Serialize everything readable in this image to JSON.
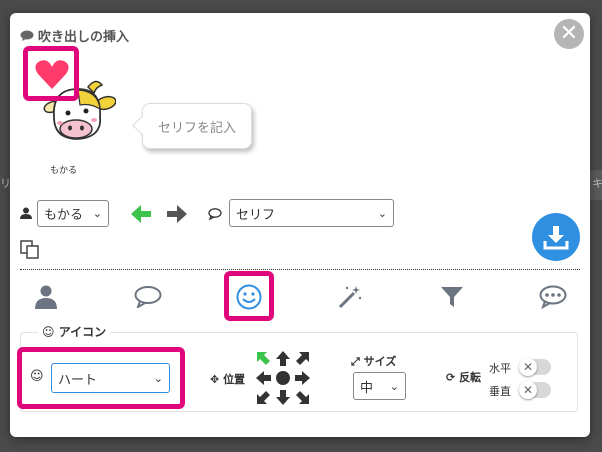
{
  "background": {
    "items": [
      "リ",
      "キ"
    ]
  },
  "dialog": {
    "title": "吹き出しの挿入",
    "close_symbol": "✕"
  },
  "character": {
    "name": "もかる",
    "speech_placeholder": "セリフを記入"
  },
  "controls": {
    "character_select": "もかる",
    "bubble_select": "セリフ"
  },
  "tabs": [
    {
      "name": "person"
    },
    {
      "name": "speech"
    },
    {
      "name": "icon",
      "active": true
    },
    {
      "name": "effect"
    },
    {
      "name": "filter"
    },
    {
      "name": "more"
    }
  ],
  "icon_section": {
    "legend": "アイコン",
    "icon_select": "ハート",
    "position_label": "位置",
    "size_label": "サイズ",
    "size_value": "中",
    "flip_label": "反転",
    "flip_horizontal": "水平",
    "flip_vertical": "垂直"
  },
  "colors": {
    "highlight": "#e0077d",
    "download": "#2f8fe0",
    "arrow_green": "#3cc34a",
    "heart": "#ff3b6b"
  }
}
